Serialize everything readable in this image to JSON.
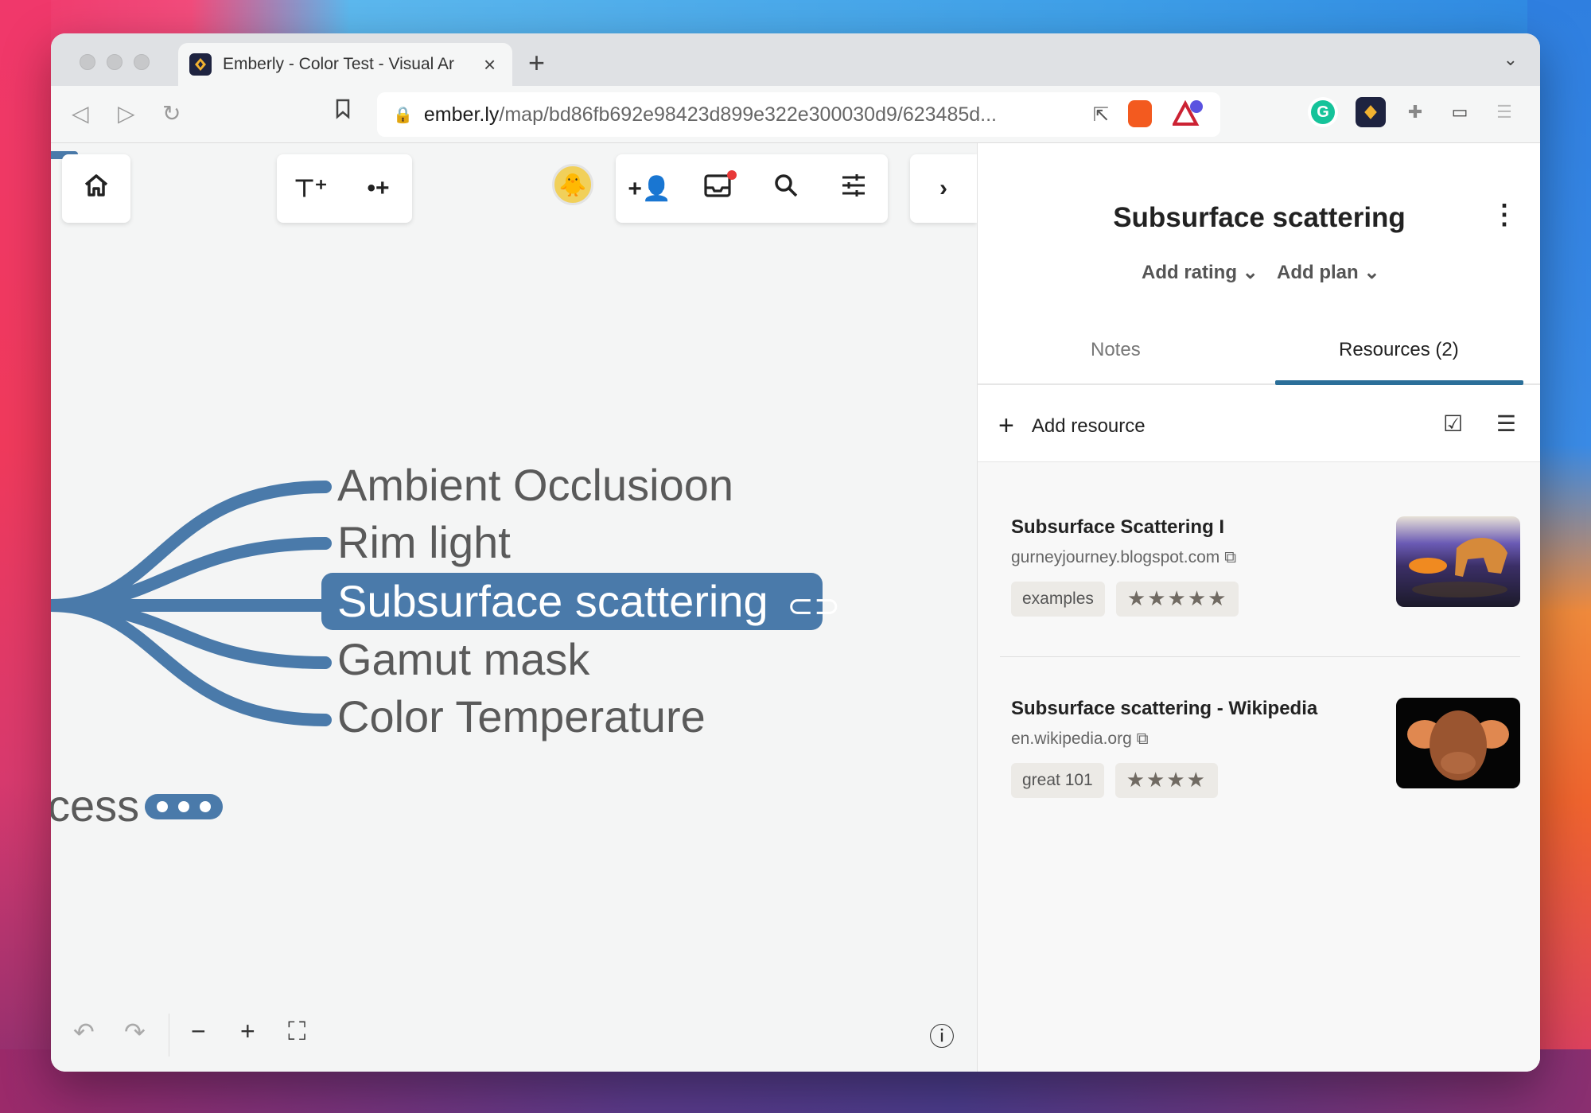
{
  "browser": {
    "tab_title": "Emberly - Color Test - Visual Ar",
    "url_host": "ember.ly",
    "url_path": "/map/bd86fb692e98423d899e322e300030d9/623485d...",
    "newtab_label": "+",
    "close_label": "×"
  },
  "mindmap": {
    "nodes": [
      "Ambient Occlusioon",
      "Rim light",
      "Gamut mask",
      "Color Temperature"
    ],
    "selected_node": "Subsurface scattering",
    "partial_node": "cess",
    "branch_color": "#4a7aaa"
  },
  "panel": {
    "title": "Subsurface scattering",
    "add_rating": "Add rating",
    "add_plan": "Add plan",
    "tabs": [
      "Notes",
      "Resources (2)"
    ],
    "active_tab": "Resources (2)",
    "add_resource": "Add resource",
    "resources": [
      {
        "title": "Subsurface Scattering I",
        "domain": "gurneyjourney.blogspot.com",
        "tag": "examples",
        "stars": "★★★★★",
        "rating": 5
      },
      {
        "title": "Subsurface scattering - Wikipedia",
        "domain": "en.wikipedia.org",
        "tag": "great 101",
        "stars": "★★★★",
        "rating": 4
      }
    ]
  },
  "colors": {
    "accent": "#2b6f99",
    "node": "#4a7aaa"
  }
}
